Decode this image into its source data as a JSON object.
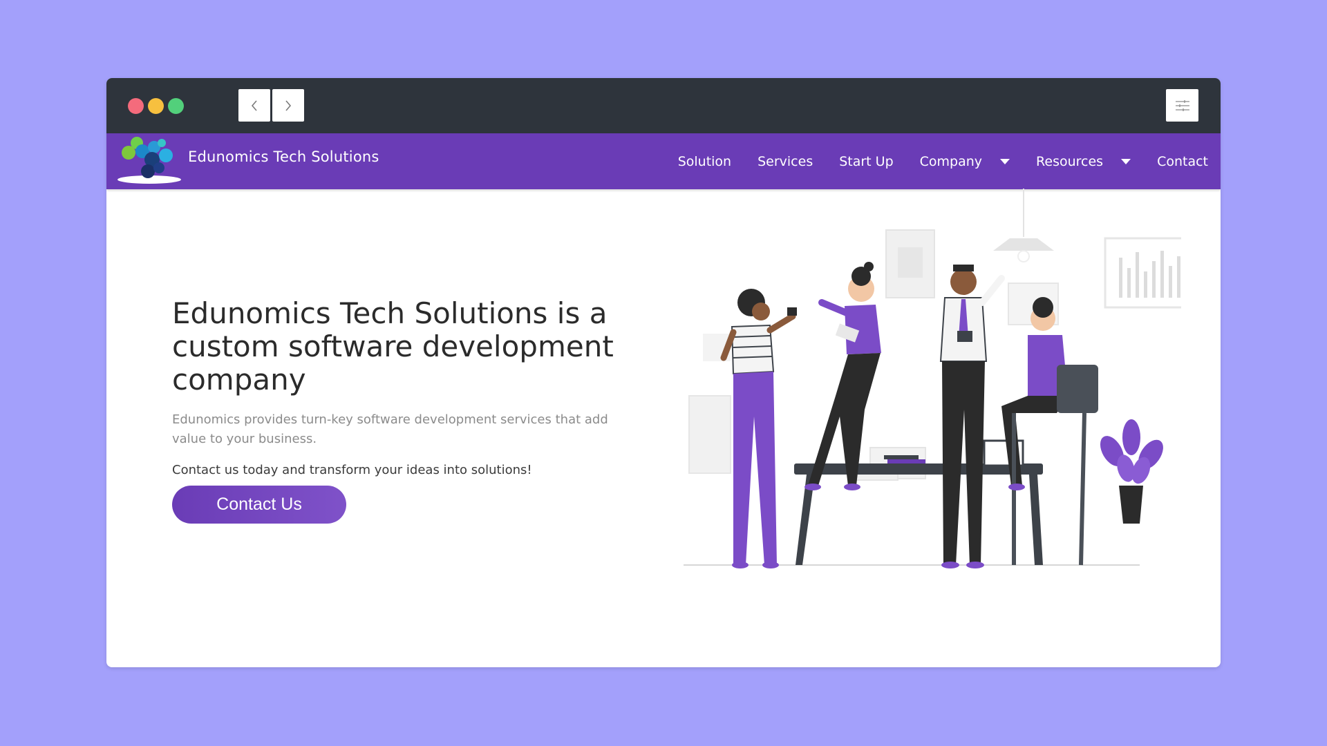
{
  "browser": {
    "back_icon": "chevron-left-icon",
    "forward_icon": "chevron-right-icon",
    "menu_icon": "sliders-icon",
    "traffic_lights": [
      "#f46b7c",
      "#f7c03f",
      "#52d07b"
    ]
  },
  "site": {
    "brand": "Edunomics Tech Solutions",
    "nav": [
      {
        "label": "Solution",
        "dropdown": false
      },
      {
        "label": "Services",
        "dropdown": false
      },
      {
        "label": "Start Up",
        "dropdown": false
      },
      {
        "label": "Company",
        "dropdown": true
      },
      {
        "label": "Resources",
        "dropdown": true
      },
      {
        "label": "Contact",
        "dropdown": false
      }
    ],
    "accent": "#6a3cb6"
  },
  "hero": {
    "headline": "Edunomics Tech Solutions is a custom software development company",
    "subtext": "Edunomics provides turn-key software development services that add value to your business.",
    "cta_text": "Contact us today and transform your ideas into solutions!",
    "cta_button": "Contact Us"
  }
}
